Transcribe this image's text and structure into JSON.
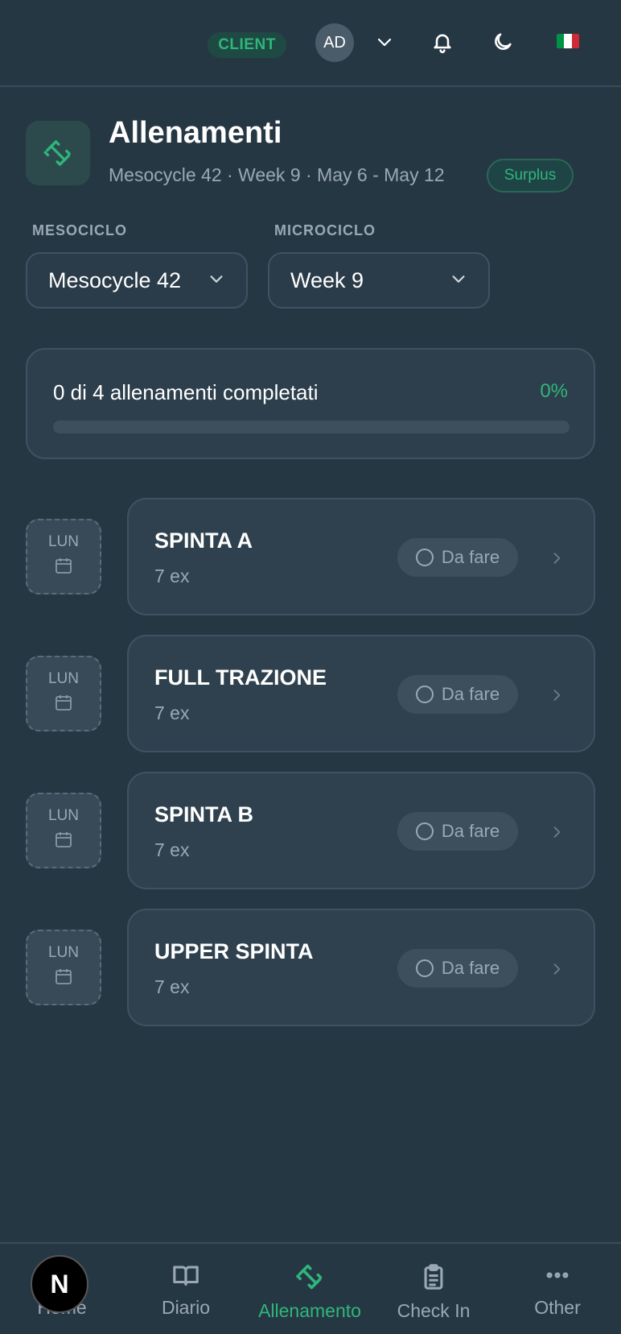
{
  "header": {
    "role_badge": "CLIENT",
    "avatar_initials": "AD",
    "flag_colors": [
      "#009246",
      "#ffffff",
      "#ce2b37"
    ]
  },
  "page": {
    "title": "Allenamenti",
    "subtitle": "Mesocycle 42 · Week 9 · May 6 - May 12",
    "phase_badge": "Surplus",
    "icon": "dumbbell-icon"
  },
  "filters": {
    "mesociclo_label": "MESOCICLO",
    "mesociclo_value": "Mesocycle 42",
    "microciclo_label": "MICROCICLO",
    "microciclo_value": "Week 9"
  },
  "progress": {
    "text": "0 di 4 allenamenti completati",
    "percent_label": "0%",
    "fraction": 0
  },
  "workouts": [
    {
      "day": "LUN",
      "name": "SPINTA A",
      "count": "7 ex",
      "status": "Da fare"
    },
    {
      "day": "LUN",
      "name": "FULL TRAZIONE",
      "count": "7 ex",
      "status": "Da fare"
    },
    {
      "day": "LUN",
      "name": "SPINTA B",
      "count": "7 ex",
      "status": "Da fare"
    },
    {
      "day": "LUN",
      "name": "UPPER SPINTA",
      "count": "7 ex",
      "status": "Da fare"
    }
  ],
  "nav": {
    "home": "Home",
    "diario": "Diario",
    "allenamento": "Allenamento",
    "checkin": "Check In",
    "other": "Other",
    "fab_letter": "N"
  },
  "colors": {
    "accent": "#2fb67a",
    "background": "#263744"
  }
}
